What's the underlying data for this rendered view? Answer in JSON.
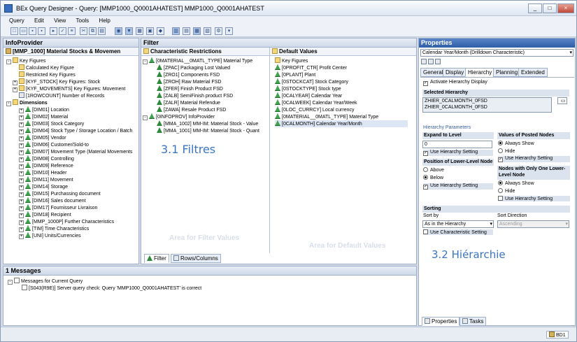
{
  "window": {
    "title": "BEx Query Designer - Query: [MMP1000_Q0001AHATEST] MMP1000_Q0001AHATEST",
    "minimize": "_",
    "restore": "□",
    "close": "×"
  },
  "menu": [
    "Query",
    "Edit",
    "View",
    "Tools",
    "Help"
  ],
  "infoprovider": {
    "header": "InfoProvider",
    "root": "[MMP_1000] Material Stocks & Movemen",
    "items": [
      "Key Figures",
      "Calculated Key Figure",
      "Restricted Key Figures",
      "[KYF_STOCK] Key Figures: Stock",
      "[KYF_MOVEMENTS] Key Figures: Movement",
      "[1ROWCOUNT] Number of Records",
      "Dimensions",
      "[DIM01] Location",
      "[DIM02] Material",
      "[DIM03] Stock Category",
      "[DIM04] Stock Type / Storage Location / Batch",
      "[DIM05] Vendor",
      "[DIM06] Customer/Sold-to",
      "[DIM07] Movement Type (Material Movements",
      "[DIM08] Controlling",
      "[DIM09] Reference",
      "[DIM10] Header",
      "[DIM11] Movement",
      "[DIM14] Storage",
      "[DIM15] Purchassing document",
      "[DIM16] Sales document",
      "[DIM17] Fournisseur Livraison",
      "[DIM18] Recipient",
      "[MMP_1000P] Further Characteristics",
      "[TIM] Time Characteristics",
      "[UNI] Units/Currencies"
    ]
  },
  "filter": {
    "header": "Filter",
    "char_restrictions": "Characteristic Restrictions",
    "default_values": "Default Values",
    "restrictions": [
      "[0MATERIAL__0MATL_TYPE] Material Type",
      "[ZPAC] Packaging Lost Valued",
      "[ZRO1] Components FSD",
      "[ZROH] Raw Material FSD",
      "[ZFER] Finish Product FSD",
      "[ZALB] SemiFinish product FSD",
      "[ZALR] Material Refendue",
      "[ZAWA] Resale Product FSD",
      "[0INFOPROV] InfoProvider",
      "[MMA_1002] MM-IM: Material Stock - Value",
      "[MMA_1001] MM-IM: Material Stock - Quant"
    ],
    "defaults": [
      "Key Figures",
      "[0PROFIT_CTR] Profit Center",
      "[0PLANT] Plant",
      "[0STOCKCAT] Stock Category",
      "[0STOCKTYPE] Stock type",
      "[0CALYEAR] Calendar Year",
      "[0CALWEEK] Calendar Year/Week",
      "[0LOC_CURRCY] Local currency",
      "[0MATERIAL__0MATL_TYPE] Material Type",
      "[0CALMONTH] Calendar Year/Month"
    ],
    "wm_filter": "Area for Filter Values",
    "wm_default": "Area for Default Values",
    "tab_filter": "Filter",
    "tab_rows": "Rows/Columns"
  },
  "overlay": {
    "filtres": "3.1 Filtres",
    "hierarchie": "3.2 Hiérarchie"
  },
  "messages": {
    "header": "1 Messages",
    "root": "Messages for Current Query",
    "msg": "[S043(R9E)] Server query check: Query 'MMP1000_Q0001AHATEST' is correct"
  },
  "properties": {
    "title": "Properties",
    "selector": "Calendar Year/Month (Drilldown Characteristic)",
    "tabs": [
      "General",
      "Display",
      "Hierarchy",
      "Planning",
      "Extended"
    ],
    "activate": "Activate Hierarchy Display",
    "selected_hierarchy": "Selected Hierarchy",
    "hier_values": [
      "ZHIER_0CALMONTH_0FSD",
      "ZHIER_0CALMONTH_0FSD"
    ],
    "hier_params": "Hierarchy Parameters",
    "expand_to_level": "Expand to Level",
    "expand_value": "0",
    "use_hier_setting": "Use Hierarchy Setting",
    "position_lower": "Position of Lower-Level Node",
    "above": "Above",
    "below": "Below",
    "values_posted": "Values of Posted Nodes",
    "always_show": "Always Show",
    "hide": "Hide",
    "nodes_only_one": "Nodes with Only One Lower-Level Node",
    "sorting": "Sorting",
    "sort_by": "Sort by",
    "sort_by_value": "As in the Hierarchy",
    "sort_direction": "Sort Direction",
    "sort_direction_value": "Ascending",
    "use_char_setting": "Use Characteristic Setting",
    "bottom_tab_props": "Properties",
    "bottom_tab_tasks": "Tasks"
  },
  "status": {
    "server": "BD1"
  }
}
